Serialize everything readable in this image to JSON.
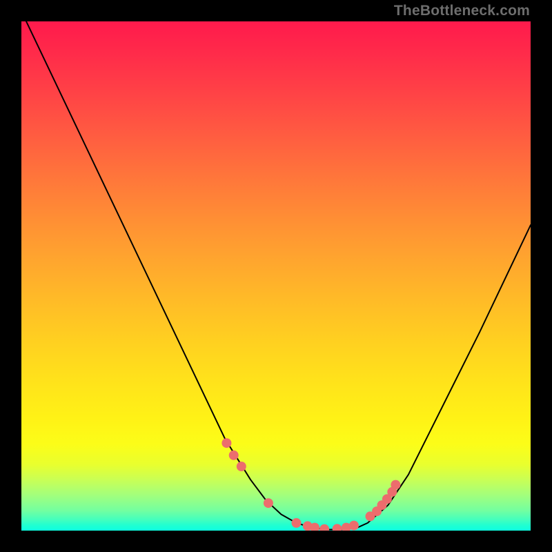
{
  "watermark": "TheBottleneck.com",
  "chart_data": {
    "type": "line",
    "title": "",
    "xlabel": "",
    "ylabel": "",
    "xlim": [
      0,
      100
    ],
    "ylim": [
      0,
      100
    ],
    "grid": false,
    "series": [
      {
        "name": "curve",
        "color": "#000000",
        "x": [
          0,
          5,
          10,
          15,
          20,
          25,
          30,
          35,
          40,
          45,
          48,
          51,
          54,
          57,
          60,
          63,
          66,
          68,
          72,
          76,
          80,
          85,
          90,
          95,
          100
        ],
        "y": [
          102,
          91.5,
          81,
          70.5,
          60,
          49.5,
          39,
          28.5,
          18,
          10,
          6,
          3.2,
          1.5,
          0.6,
          0.2,
          0.2,
          0.6,
          1.5,
          5,
          11,
          19,
          29,
          39,
          49.5,
          60
        ]
      },
      {
        "name": "markers",
        "color": "#ec6d6d",
        "type": "scatter",
        "x": [
          40.3,
          41.7,
          43.2,
          48.5,
          54.0,
          56.2,
          57.6,
          59.5,
          62.0,
          63.8,
          65.3,
          68.5,
          69.8,
          70.8,
          71.8,
          72.8,
          73.5
        ],
        "y": [
          17.2,
          14.8,
          12.6,
          5.4,
          1.5,
          0.9,
          0.6,
          0.3,
          0.35,
          0.6,
          1.0,
          2.8,
          3.8,
          5.0,
          6.2,
          7.6,
          9.0
        ]
      }
    ],
    "background_gradient": {
      "type": "vertical",
      "stops": [
        {
          "pos": 0.0,
          "color": "#ff1a4c"
        },
        {
          "pos": 0.5,
          "color": "#ffb928"
        },
        {
          "pos": 0.82,
          "color": "#fcfd18"
        },
        {
          "pos": 1.0,
          "color": "#0dffe0"
        }
      ]
    }
  }
}
